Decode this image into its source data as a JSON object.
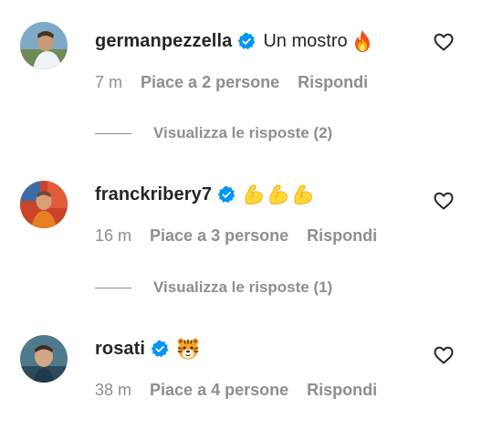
{
  "comments": [
    {
      "username": "germanpezzella",
      "verified": true,
      "text": "Un mostro",
      "emojis": [
        "fire"
      ],
      "time": "7 m",
      "likes": "Piace a 2 persone",
      "reply_label": "Rispondi",
      "view_replies": "Visualizza le risposte (2)"
    },
    {
      "username": "franckribery7",
      "verified": true,
      "text": "",
      "emojis": [
        "flexed-biceps",
        "flexed-biceps",
        "flexed-biceps"
      ],
      "time": "16 m",
      "likes": "Piace a 3 persone",
      "reply_label": "Rispondi",
      "view_replies": "Visualizza le risposte (1)"
    },
    {
      "username": "rosati",
      "verified": true,
      "text": "",
      "emojis": [
        "tiger-face"
      ],
      "time": "38 m",
      "likes": "Piace a 4 persone",
      "reply_label": "Rispondi"
    }
  ],
  "colors": {
    "text": "#262626",
    "secondary": "#8e8e8e",
    "verified": "#0095f6",
    "background": "#ffffff"
  },
  "icons": [
    "verified-badge-icon",
    "heart-outline-icon",
    "fire-emoji-icon",
    "flexed-biceps-emoji-icon",
    "tiger-face-emoji-icon"
  ]
}
